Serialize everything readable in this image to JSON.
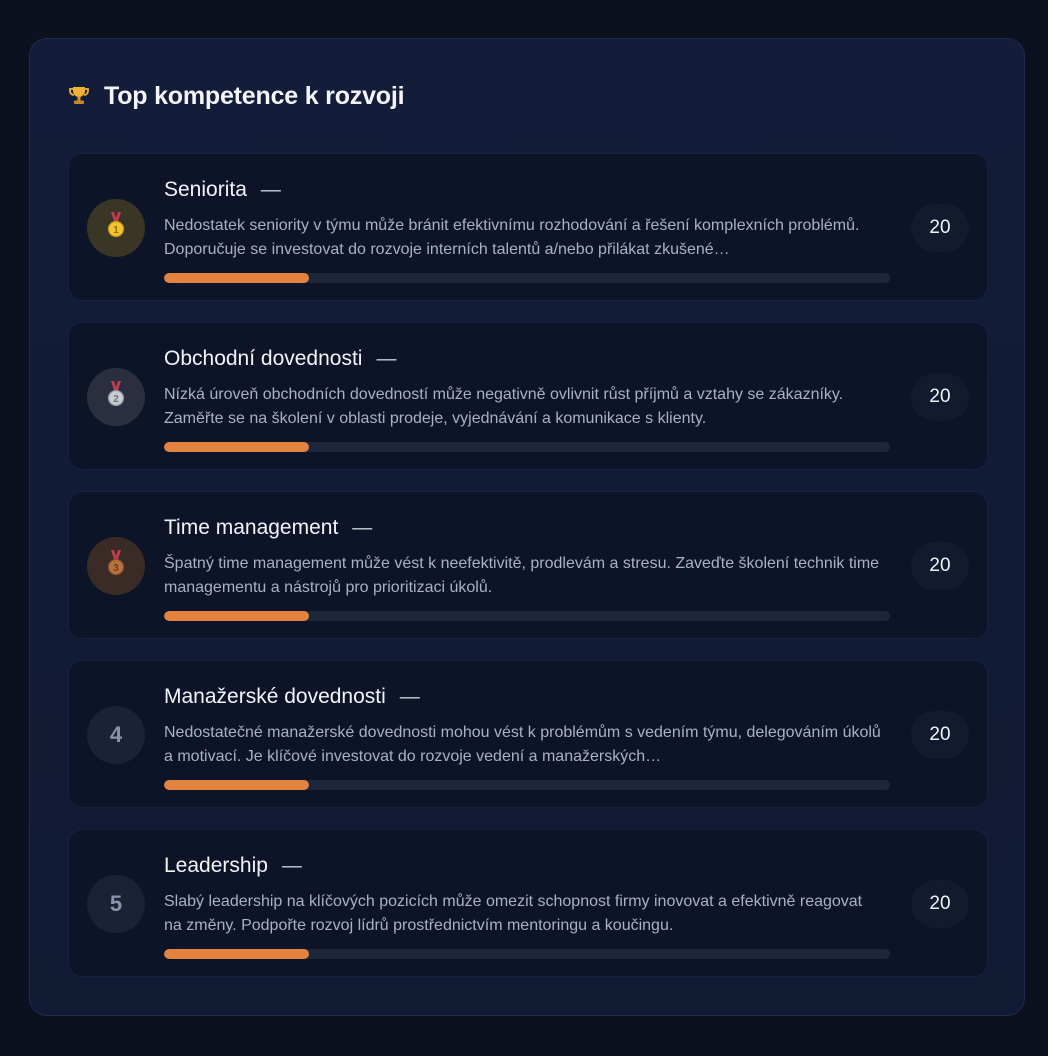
{
  "header": {
    "title": "Top kompetence k rozvoji",
    "icon": "trophy-icon"
  },
  "colors": {
    "accent": "#e4833f",
    "bar_track": "#1e2639",
    "card_bg": "#131c38",
    "item_bg": "#0d1427"
  },
  "items": [
    {
      "rank_label": "",
      "rank_icon": "gold-medal-icon",
      "title": "Seniorita",
      "dash": "—",
      "description": "Nedostatek seniority v týmu může bránit efektivnímu rozhodování a řešení komplexních problémů. Doporučuje se investovat do rozvoje interních talentů a/nebo přilákat zkušené…",
      "score": "20",
      "progress": 0.2
    },
    {
      "rank_label": "",
      "rank_icon": "silver-medal-icon",
      "title": "Obchodní dovednosti",
      "dash": "—",
      "description": "Nízká úroveň obchodních dovedností může negativně ovlivnit růst příjmů a vztahy se zákazníky. Zaměřte se na školení v oblasti prodeje, vyjednávání a komunikace s klienty.",
      "score": "20",
      "progress": 0.2
    },
    {
      "rank_label": "",
      "rank_icon": "bronze-medal-icon",
      "title": "Time management",
      "dash": "—",
      "description": "Špatný time management může vést k neefektivitě, prodlevám a stresu. Zaveďte školení technik time managementu a nástrojů pro prioritizaci úkolů.",
      "score": "20",
      "progress": 0.2
    },
    {
      "rank_label": "4",
      "rank_icon": "",
      "title": "Manažerské dovednosti",
      "dash": "—",
      "description": "Nedostatečné manažerské dovednosti mohou vést k problémům s vedením týmu, delegováním úkolů a motivací. Je klíčové investovat do rozvoje vedení a manažerských…",
      "score": "20",
      "progress": 0.2
    },
    {
      "rank_label": "5",
      "rank_icon": "",
      "title": "Leadership",
      "dash": "—",
      "description": "Slabý leadership na klíčových pozicích může omezit schopnost firmy inovovat a efektivně reagovat na změny. Podpořte rozvoj lídrů prostřednictvím mentoringu a koučingu.",
      "score": "20",
      "progress": 0.2
    }
  ]
}
